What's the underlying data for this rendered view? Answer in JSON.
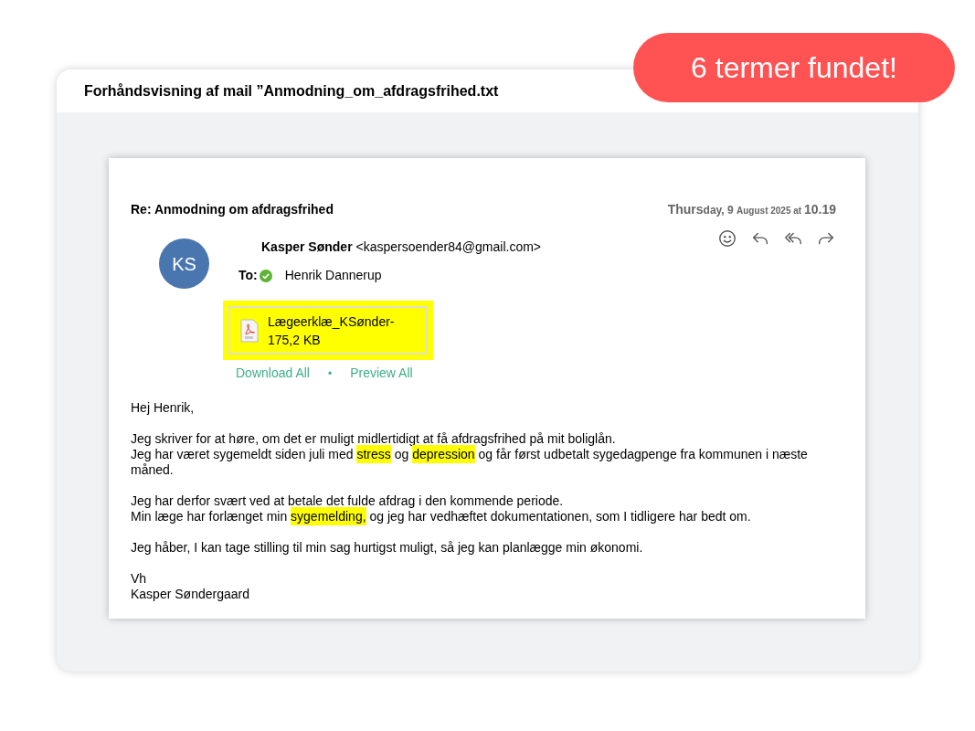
{
  "badge": {
    "text": "6 termer fundet!"
  },
  "window": {
    "title": "Forhåndsvisning af mail ”Anmodning_om_afdragsfrihed.txt"
  },
  "email": {
    "subject": "Re: Anmodning om afdragsfrihed",
    "date": [
      {
        "text": "Thurs",
        "kind": "large"
      },
      {
        "text": "day, 9 ",
        "kind": "medium"
      },
      {
        "text": "August 2025 at ",
        "kind": "small"
      },
      {
        "text": "10.19",
        "kind": "large"
      }
    ],
    "avatar": "KS",
    "sender_name": "Kasper Sønder",
    "sender_email": "<kaspersoender84@gmail.com>",
    "to_label": "To:",
    "recipient": "Henrik Dannerup",
    "recipient_verified": true,
    "attachment": {
      "name": "Lægeerklæ_KSønder-",
      "size": "175,2 KB",
      "highlighted": true
    },
    "links": [
      "Download All",
      "Preview All"
    ],
    "link_separator": "•",
    "paragraphs": [
      [
        [
          {
            "text": "Hej Henrik,",
            "highlighted": false
          }
        ]
      ],
      [
        [
          {
            "text": "Jeg skriver for at høre, om det er muligt midlertidigt at få afdragsfrihed på mit boliglån.",
            "highlighted": false
          }
        ],
        [
          {
            "text": "Jeg har været sygemeldt siden juli med ",
            "highlighted": false
          },
          {
            "text": "stress",
            "highlighted": true
          },
          {
            "text": " og ",
            "highlighted": false
          },
          {
            "text": "depression",
            "highlighted": true
          },
          {
            "text": " og får først udbetalt sygedagpenge fra kommunen i næste måned.",
            "highlighted": false
          }
        ]
      ],
      [
        [
          {
            "text": "Jeg har derfor svært ved at betale det fulde afdrag i den kommende periode.",
            "highlighted": false
          }
        ],
        [
          {
            "text": "Min læge har forlænget min ",
            "highlighted": false
          },
          {
            "text": "sygemelding,",
            "highlighted": true
          },
          {
            "text": " og jeg har vedhæftet dokumentationen, som I tidligere har bedt om.",
            "highlighted": false
          }
        ]
      ],
      [
        [
          {
            "text": "Jeg håber, I kan tage stilling til min sag hurtigst muligt, så jeg kan planlægge min økonomi.",
            "highlighted": false
          }
        ]
      ],
      [
        [
          {
            "text": "Vh",
            "highlighted": false
          }
        ],
        [
          {
            "text": "Kasper Søndergaard",
            "highlighted": false
          }
        ]
      ]
    ]
  }
}
